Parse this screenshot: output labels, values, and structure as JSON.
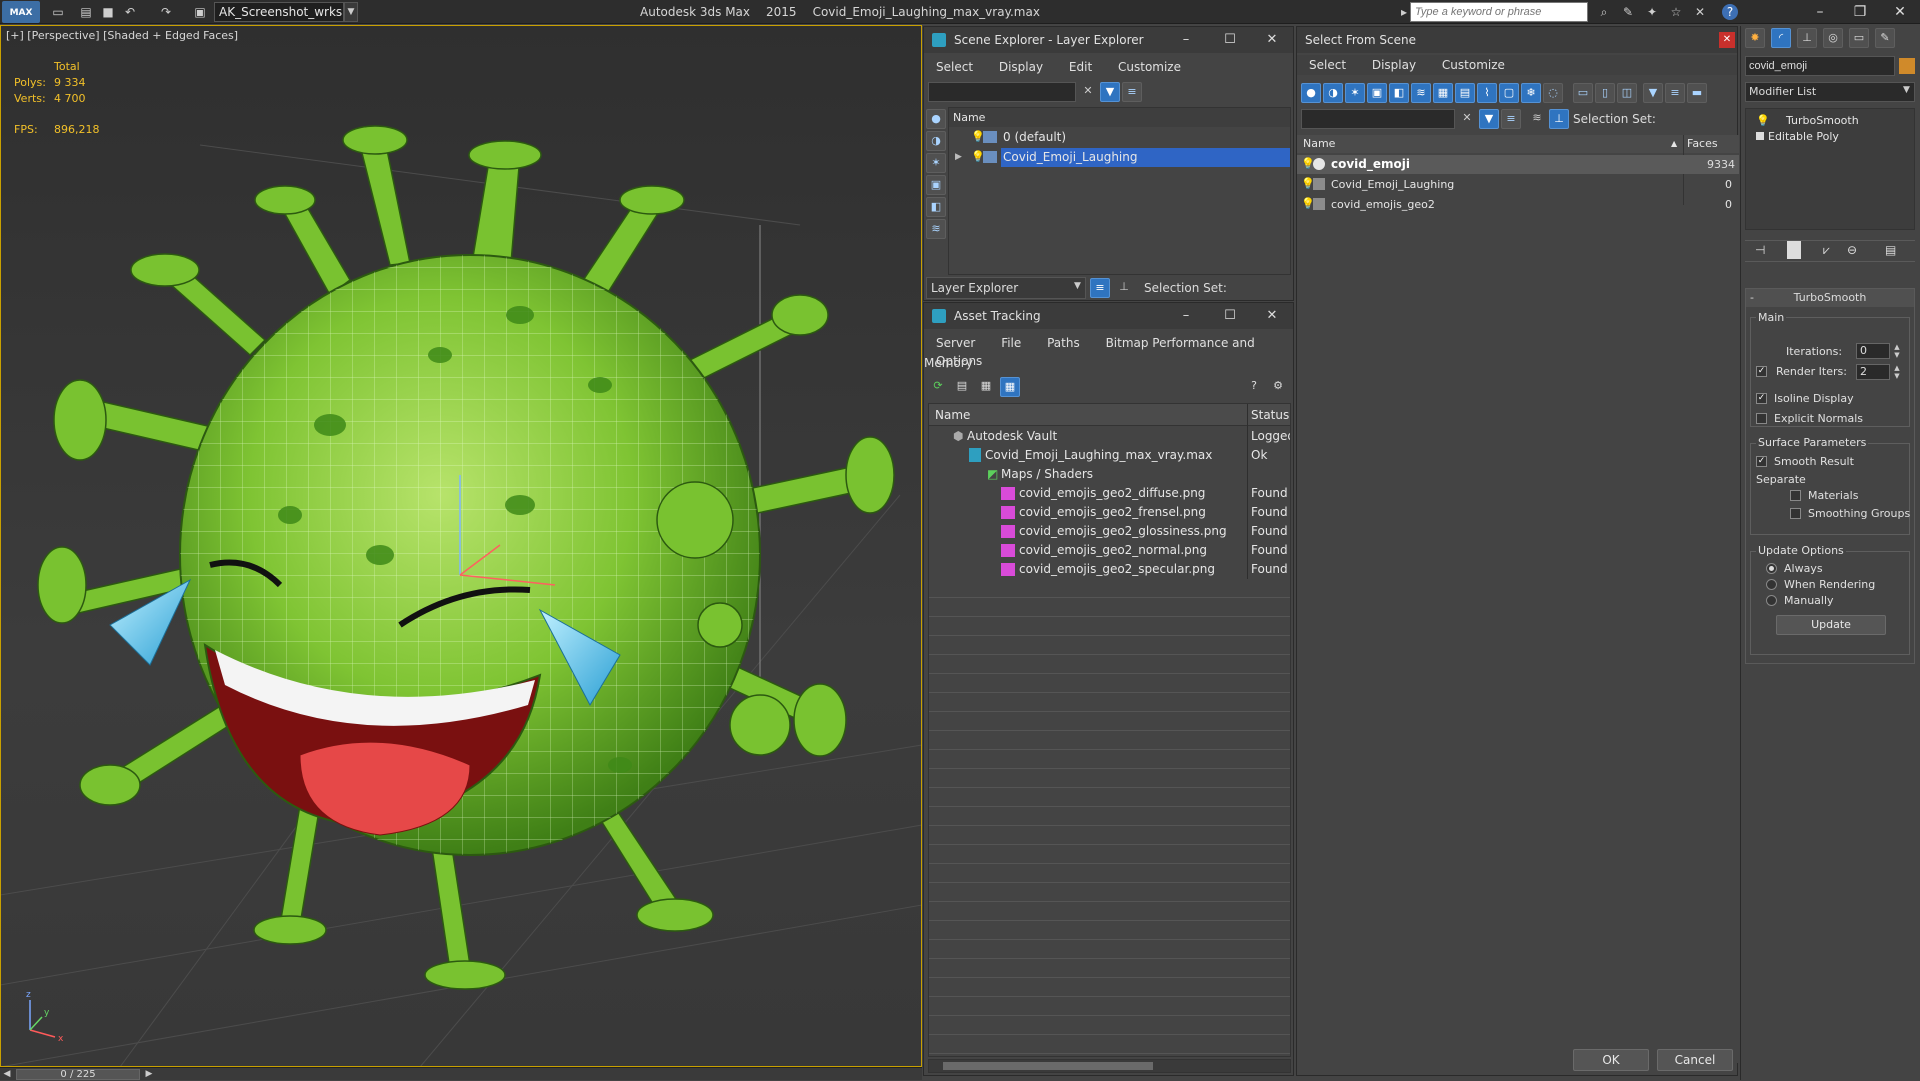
{
  "titlebar": {
    "logo": "MAX",
    "workspace": "AK_Screenshot_wrksp",
    "app_name": "Autodesk 3ds Max",
    "version": "2015",
    "file_name": "Covid_Emoji_Laughing_max_vray.max",
    "search_placeholder": "Type a keyword or phrase"
  },
  "viewport": {
    "label": "[+] [Perspective] [Shaded + Edged Faces]",
    "stats_header": "Total",
    "polys_label": "Polys:",
    "polys_value": "9 334",
    "verts_label": "Verts:",
    "verts_value": "4 700",
    "fps_label": "FPS:",
    "fps_value": "896,218",
    "axis_z": "z",
    "axis_x": "x",
    "axis_y": "y"
  },
  "timeline": {
    "frame": "0 / 225"
  },
  "scene_explorer": {
    "title": "Scene Explorer - Layer Explorer",
    "menu": [
      "Select",
      "Display",
      "Edit",
      "Customize"
    ],
    "column_name": "Name",
    "rows": [
      {
        "name": "0 (default)",
        "selected": false
      },
      {
        "name": "Covid_Emoji_Laughing",
        "selected": true
      }
    ],
    "footer_dropdown": "Layer Explorer",
    "selection_set_label": "Selection Set:"
  },
  "asset_tracking": {
    "title": "Asset Tracking",
    "menu": [
      "Server",
      "File",
      "Paths",
      "Bitmap Performance and Memory"
    ],
    "menu2": "Options",
    "col_name": "Name",
    "col_status": "Status",
    "rows": [
      {
        "name": "Autodesk Vault",
        "status": "Logged",
        "indent": 0
      },
      {
        "name": "Covid_Emoji_Laughing_max_vray.max",
        "status": "Ok",
        "indent": 1
      },
      {
        "name": "Maps / Shaders",
        "status": "",
        "indent": 2
      },
      {
        "name": "covid_emojis_geo2_diffuse.png",
        "status": "Found",
        "indent": 3
      },
      {
        "name": "covid_emojis_geo2_frensel.png",
        "status": "Found",
        "indent": 3
      },
      {
        "name": "covid_emojis_geo2_glossiness.png",
        "status": "Found",
        "indent": 3
      },
      {
        "name": "covid_emojis_geo2_normal.png",
        "status": "Found",
        "indent": 3
      },
      {
        "name": "covid_emojis_geo2_specular.png",
        "status": "Found",
        "indent": 3
      }
    ]
  },
  "select_from_scene": {
    "title": "Select From Scene",
    "menu": [
      "Select",
      "Display",
      "Customize"
    ],
    "selection_set_label": "Selection Set:",
    "col_name": "Name",
    "col_faces": "Faces",
    "rows": [
      {
        "name": "covid_emoji",
        "faces": "9334",
        "selected": true
      },
      {
        "name": "Covid_Emoji_Laughing",
        "faces": "0",
        "selected": false
      },
      {
        "name": "covid_emojis_geo2",
        "faces": "0",
        "selected": false
      }
    ],
    "ok": "OK",
    "cancel": "Cancel"
  },
  "modifier_panel": {
    "object_name": "covid_emoji",
    "modifier_list": "Modifier List",
    "stack": [
      "TurboSmooth",
      "Editable Poly"
    ],
    "rollout_title": "TurboSmooth",
    "main_label": "Main",
    "iterations_label": "Iterations:",
    "iterations_value": "0",
    "render_iters_label": "Render Iters:",
    "render_iters_value": "2",
    "isoline_label": "Isoline Display",
    "explicit_normals_label": "Explicit Normals",
    "surface_label": "Surface Parameters",
    "smooth_result_label": "Smooth Result",
    "separate_label": "Separate",
    "materials_label": "Materials",
    "smoothing_groups_label": "Smoothing Groups",
    "update_options_label": "Update Options",
    "always_label": "Always",
    "when_rendering_label": "When Rendering",
    "manually_label": "Manually",
    "update_button": "Update"
  },
  "colors": {
    "selection_blue": "#2f65c5",
    "viewport_border": "#c8a000",
    "stats_yellow": "#f2c029",
    "virus_green": "#6fba2c"
  }
}
